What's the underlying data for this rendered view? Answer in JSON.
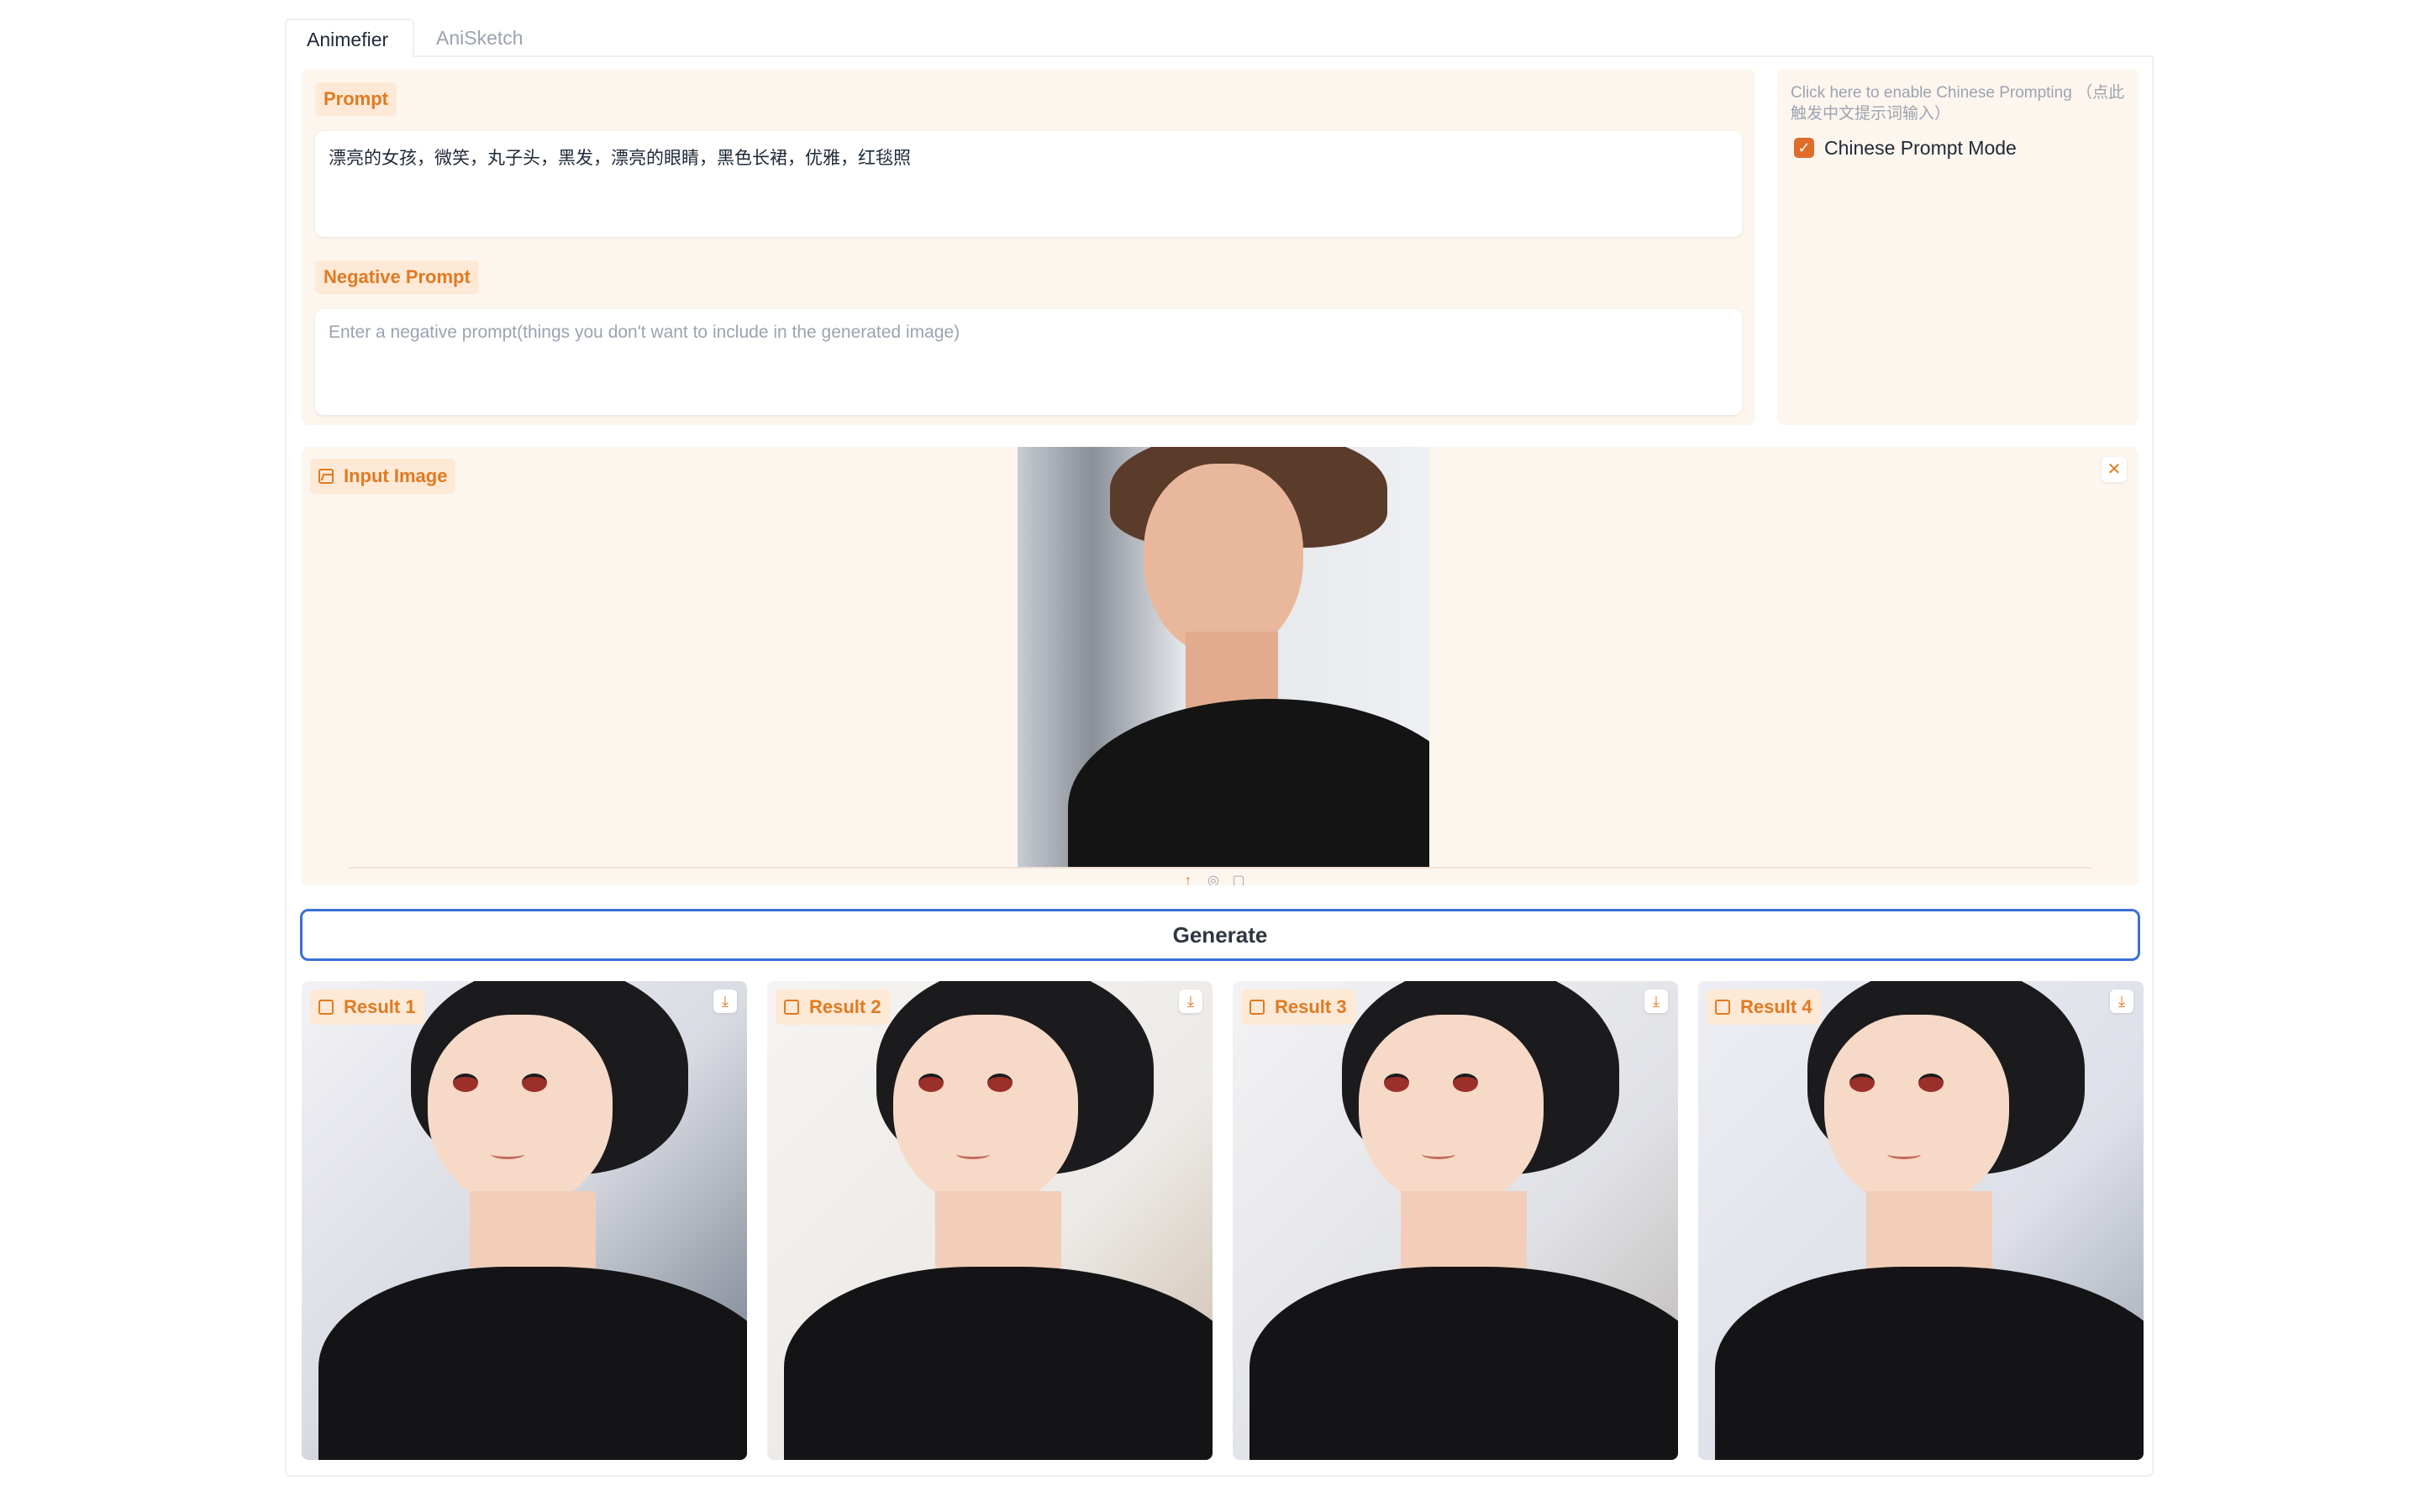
{
  "tabs": [
    {
      "label": "Animefier",
      "active": true
    },
    {
      "label": "AniSketch",
      "active": false
    }
  ],
  "prompt": {
    "label": "Prompt",
    "value": "漂亮的女孩，微笑，丸子头，黑发，漂亮的眼睛，黑色长裙，优雅，红毯照"
  },
  "negative_prompt": {
    "label": "Negative Prompt",
    "value": "",
    "placeholder": "Enter a negative prompt(things you don't want to include in the generated image)"
  },
  "chinese_mode": {
    "info": "Click here to enable Chinese Prompting （点此触发中文提示词输入）",
    "checkbox_label": "Chinese Prompt Mode",
    "checked": true
  },
  "input_image": {
    "label": "Input Image",
    "close_icon": "close-icon",
    "tool_icons": [
      "upload-icon",
      "webcam-icon",
      "clipboard-icon"
    ]
  },
  "generate": {
    "label": "Generate"
  },
  "results": [
    {
      "label": "Result 1"
    },
    {
      "label": "Result 2"
    },
    {
      "label": "Result 3"
    },
    {
      "label": "Result 4"
    }
  ],
  "colors": {
    "accent": "#e07a22",
    "panel_bg": "#fdf6ef",
    "label_bg": "#fde9d6",
    "button_border": "#3b6fd6"
  }
}
